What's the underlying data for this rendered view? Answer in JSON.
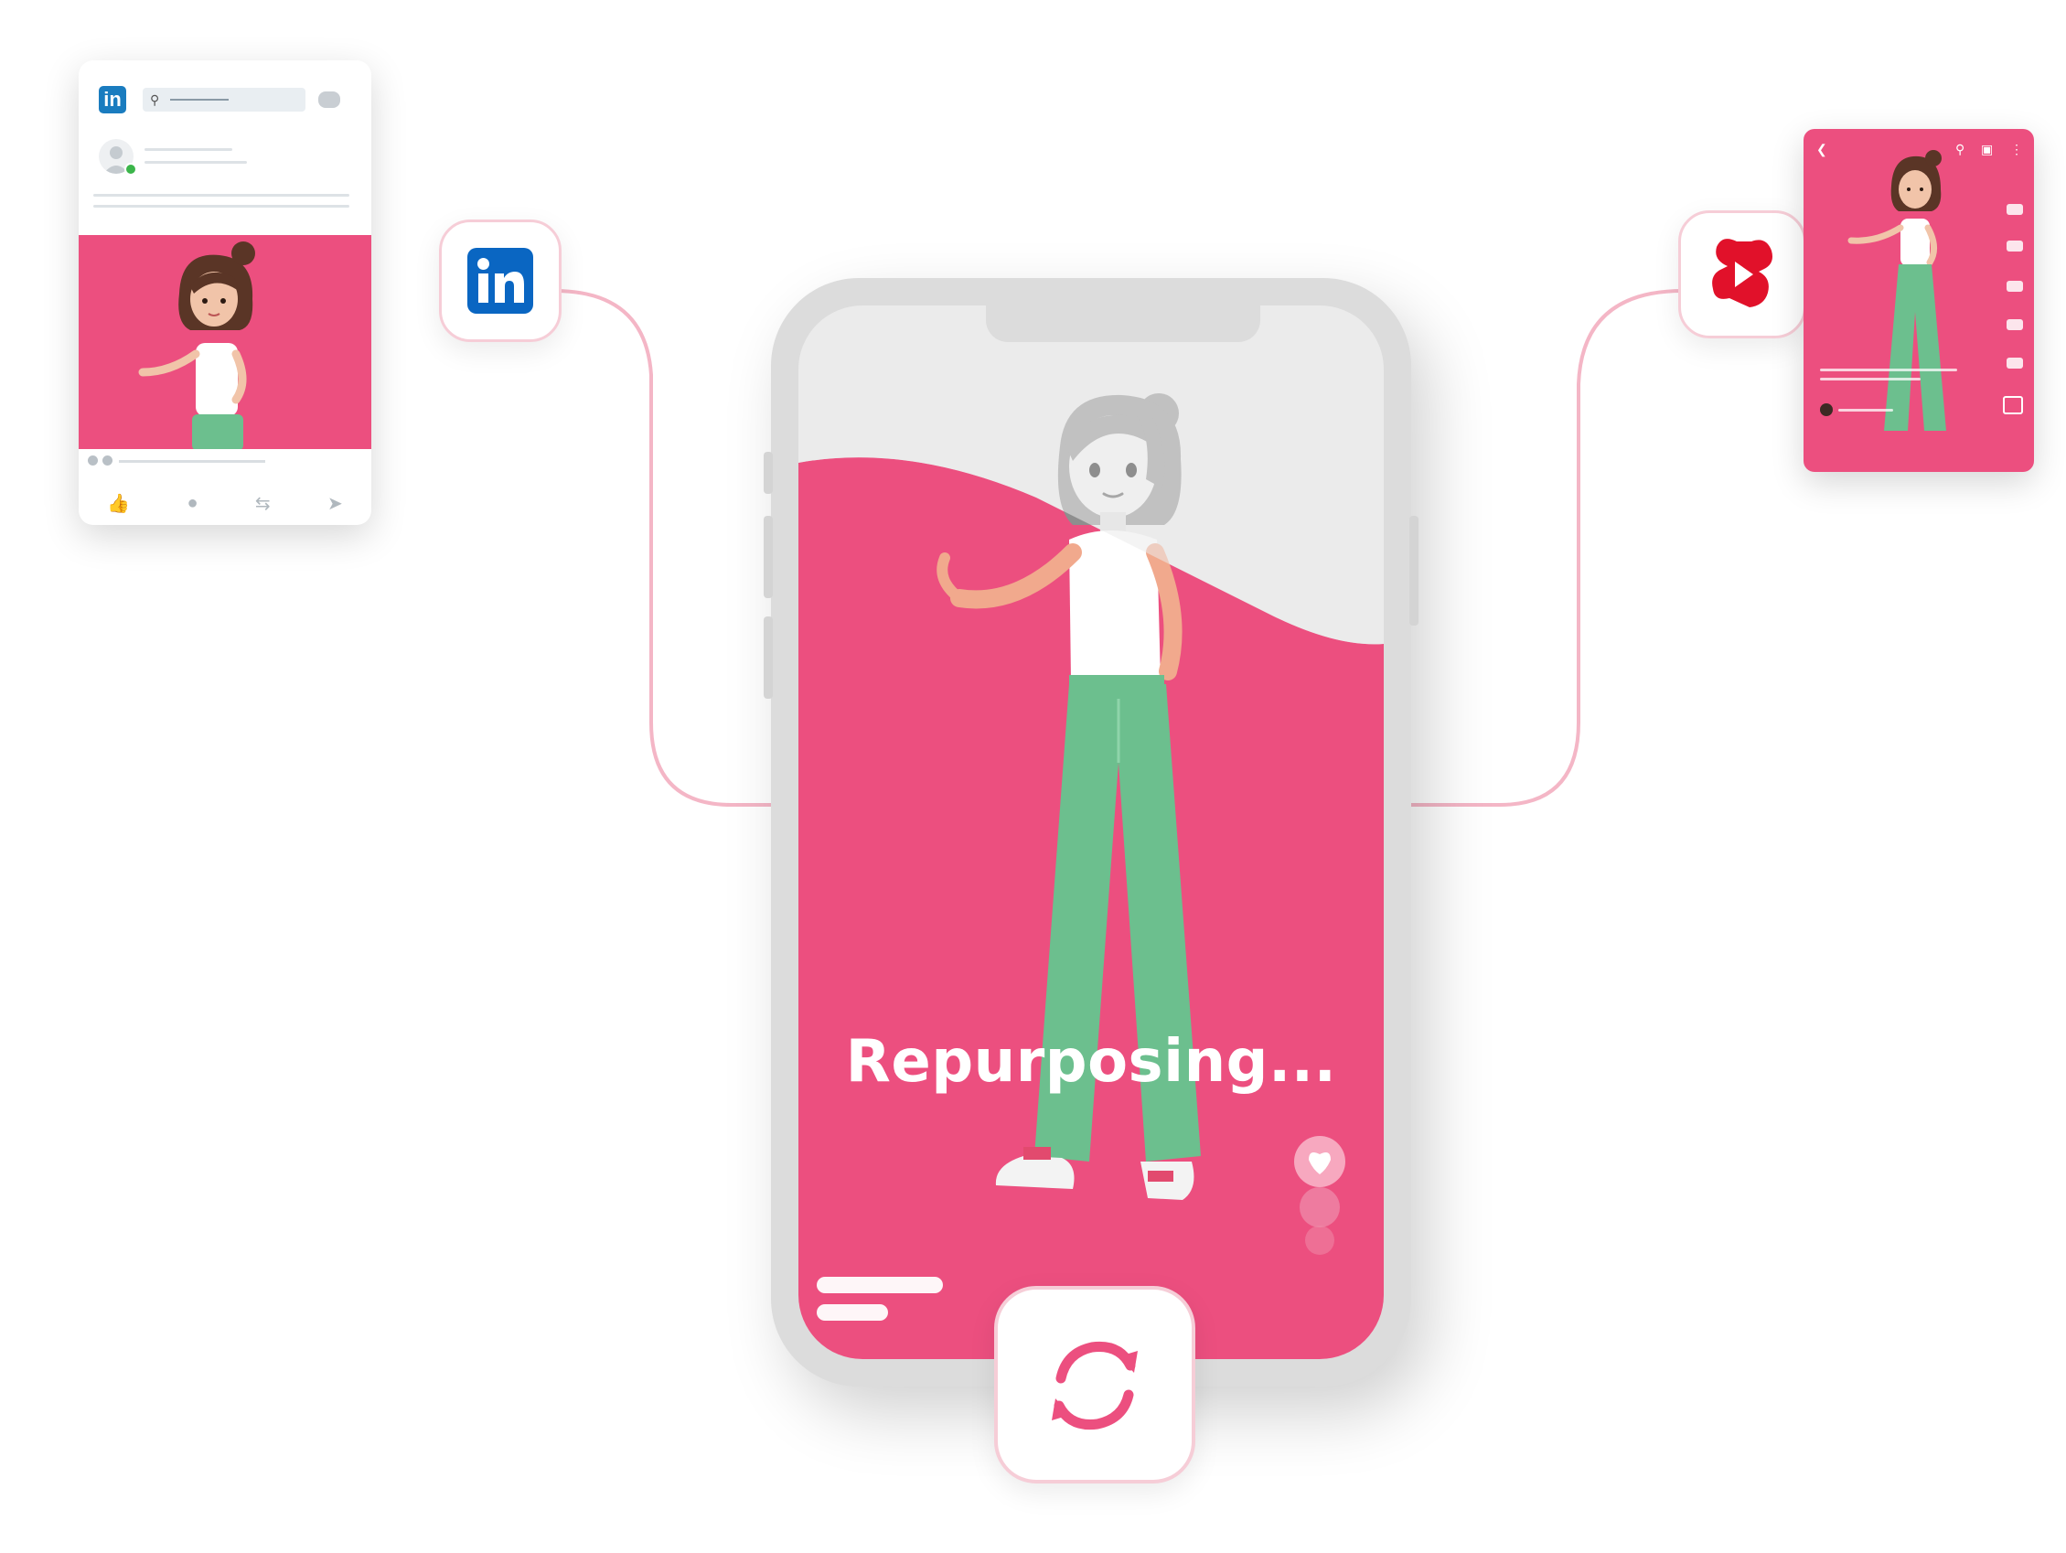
{
  "caption": "Repurposing...",
  "platforms": {
    "source": {
      "name": "LinkedIn",
      "logo_text": "in",
      "icon": "linkedin-icon",
      "color": "#0a66c2"
    },
    "target": {
      "name": "YouTube Shorts",
      "icon": "youtube-shorts-icon",
      "color": "#e1112a"
    }
  },
  "center_action_icon": "refresh-icon",
  "colors": {
    "accent_pink": "#ec4f7f",
    "pants_green": "#6cbf8e",
    "connector": "#f4b6c6",
    "background": "#ffffff"
  }
}
